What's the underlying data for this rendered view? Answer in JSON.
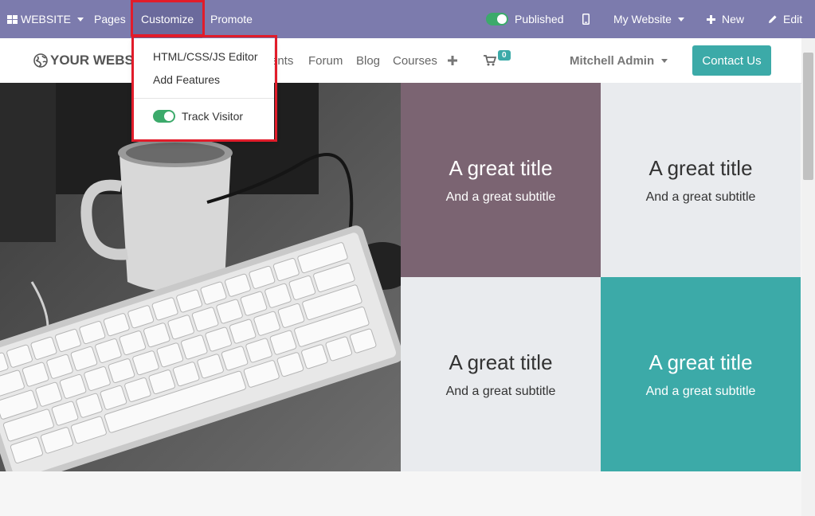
{
  "adminbar": {
    "website_label": "WEBSITE",
    "pages_label": "Pages",
    "customize_label": "Customize",
    "promote_label": "Promote",
    "published_label": "Published",
    "my_website_label": "My Website",
    "new_label": "New",
    "edit_label": "Edit"
  },
  "customize_menu": {
    "items": [
      {
        "label": "HTML/CSS/JS Editor"
      },
      {
        "label": "Add Features"
      }
    ],
    "track_visitor_label": "Track Visitor"
  },
  "sitenav": {
    "logo_text": "YOUR WEBSI",
    "items": [
      {
        "label": "ents"
      },
      {
        "label": "Forum"
      },
      {
        "label": "Blog"
      },
      {
        "label": "Courses"
      }
    ],
    "cart_count": "0",
    "user_name": "Mitchell Admin",
    "contact_label": "Contact Us"
  },
  "tiles": [
    {
      "title": "A great title",
      "subtitle": "And a great subtitle",
      "bg": "#7b6472",
      "fg": "#ffffff"
    },
    {
      "title": "A great title",
      "subtitle": "And a great subtitle",
      "bg": "#e9ebee",
      "fg": "#333333"
    },
    {
      "title": "A great title",
      "subtitle": "And a great subtitle",
      "bg": "#e9ebee",
      "fg": "#333333"
    },
    {
      "title": "A great title",
      "subtitle": "And a great subtitle",
      "bg": "#3caaa8",
      "fg": "#ffffff"
    }
  ],
  "colors": {
    "adminbar": "#7c7bad",
    "accent": "#3caaa8",
    "highlight": "#e11c2a",
    "toggle_on": "#3caa6b"
  }
}
